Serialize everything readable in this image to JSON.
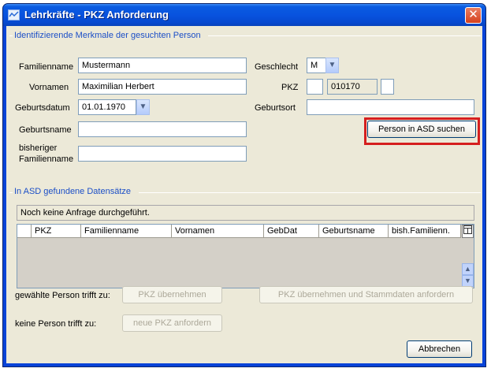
{
  "window": {
    "title": "Lehrkräfte - PKZ Anforderung",
    "close_glyph": "✕"
  },
  "group_search": {
    "title": "Identifizierende Merkmale der gesuchten Person",
    "familienname_label": "Familienname",
    "familienname_value": "Mustermann",
    "vornamen_label": "Vornamen",
    "vornamen_value": "Maximilian Herbert",
    "geburtsdatum_label": "Geburtsdatum",
    "geburtsdatum_value": "01.01.1970",
    "geburtsname_label": "Geburtsname",
    "geburtsname_value": "",
    "bisheriger_label_1": "bisheriger",
    "bisheriger_label_2": "Familienname",
    "bisheriger_value": "",
    "geschlecht_label": "Geschlecht",
    "geschlecht_value": "M",
    "pkz_label": "PKZ",
    "pkz_part1": "",
    "pkz_part2": "010170",
    "pkz_part3": "",
    "geburtsort_label": "Geburtsort",
    "geburtsort_value": "",
    "search_button": "Person in ASD suchen"
  },
  "group_results": {
    "title": "In ASD gefundene Datensätze",
    "status": "Noch keine Anfrage durchgeführt.",
    "columns": [
      "",
      "PKZ",
      "Familienname",
      "Vornamen",
      "GebDat",
      "Geburtsname",
      "bish.Familienn."
    ]
  },
  "actions": {
    "gewaehlte_label": "gewählte Person trifft zu:",
    "pkz_uebernehmen": "PKZ übernehmen",
    "pkz_uebernehmen_stammdaten": "PKZ übernehmen und Stammdaten anfordern",
    "keine_label": "keine Person trifft zu:",
    "neue_pkz": "neue PKZ anfordern",
    "abbrechen": "Abbrechen"
  },
  "colors": {
    "highlight": "#d51f1f",
    "group_title": "#1c4fc7"
  }
}
